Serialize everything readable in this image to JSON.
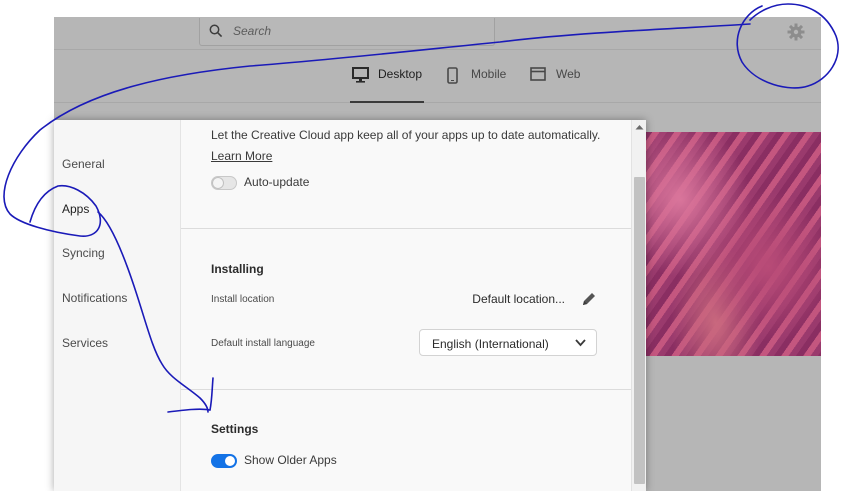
{
  "search": {
    "placeholder": "Search"
  },
  "icons": {
    "search": "search-icon",
    "gear": "gear-icon",
    "desktop": "desktop-icon",
    "mobile": "mobile-icon",
    "web": "web-icon",
    "pencil": "pencil-icon",
    "chevron": "chevron-down-icon"
  },
  "tabs": [
    {
      "label": "Desktop",
      "active": true
    },
    {
      "label": "Mobile",
      "active": false
    },
    {
      "label": "Web",
      "active": false
    }
  ],
  "sidebar": {
    "items": [
      {
        "label": "General"
      },
      {
        "label": "Apps",
        "active": true
      },
      {
        "label": "Syncing"
      },
      {
        "label": "Notifications"
      },
      {
        "label": "Services"
      }
    ]
  },
  "auto_update": {
    "description": "Let the Creative Cloud app keep all of your apps up to date automatically.",
    "learn_more": "Learn More",
    "toggle_label": "Auto-update",
    "enabled": false
  },
  "installing": {
    "title": "Installing",
    "location_label": "Install location",
    "location_value": "Default location...",
    "language_label": "Default install language",
    "language_value": "English (International)"
  },
  "settings": {
    "title": "Settings",
    "older_apps_label": "Show Older Apps",
    "older_apps_enabled": true
  },
  "colors": {
    "accent": "#1473e6",
    "annotation": "#1a1ab8"
  }
}
